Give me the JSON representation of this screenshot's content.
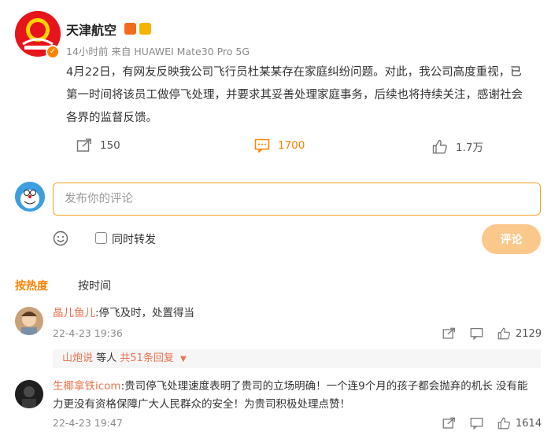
{
  "post": {
    "author": "天津航空",
    "meta": "14小时前  来自 HUAWEI Mate30 Pro 5G",
    "text": "4月22日，有网友反映我公司飞行员杜某某存在家庭纠纷问题。对此，我公司高度重视，已第一时间将该员工做停飞处理，并要求其妥善处理家庭事务，后续也将持续关注，感谢社会各界的监督反馈。",
    "share_count": "150",
    "comment_count": "1700",
    "like_count": "1.7万"
  },
  "composer": {
    "placeholder": "发布你的评论",
    "repost_label": "同时转发",
    "submit_label": "评论"
  },
  "tabs": {
    "hot": "按热度",
    "time": "按时间"
  },
  "comments": [
    {
      "name": "晶儿鱼儿",
      "text": ":停飞及时，处置得当",
      "time": "22-4-23 19:36",
      "likes": "2129",
      "replies": {
        "user": "山炮说",
        "mid": " 等人 ",
        "count": "共51条回复"
      }
    },
    {
      "name": "生椰拿铁icom",
      "text": ":贵司停飞处理速度表明了贵司的立场明确！一个连9个月的孩子都会抛弃的机长 没有能力更没有资格保障广大人民群众的安全！为贵司积极处理点赞！",
      "time": "22-4-23 19:47",
      "likes": "1614"
    }
  ],
  "colors": {
    "accent": "#ff8200",
    "name": "#eb7350",
    "submit_disabled": "#fbc88c"
  },
  "icons": [
    "verified-icon",
    "share-icon",
    "comment-icon",
    "like-icon",
    "emoji-icon",
    "reply-icon",
    "chevron-down-icon"
  ]
}
